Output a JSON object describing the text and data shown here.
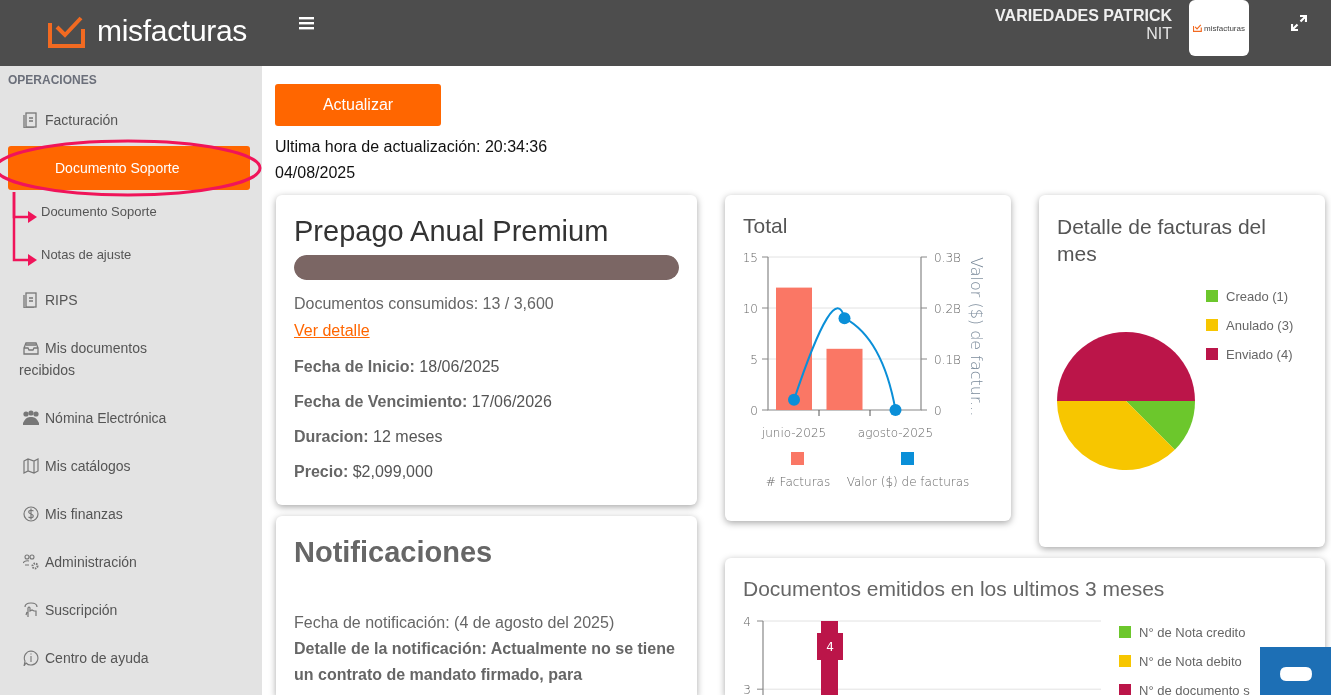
{
  "header": {
    "logo": "misfacturas",
    "company": "VARIEDADES PATRICK",
    "nit": "NIT",
    "avatar_logo": "misfacturas"
  },
  "sidebar": {
    "section": "OPERACIONES",
    "items": [
      {
        "label": "Facturación",
        "selected": false,
        "children": [
          {
            "label": "Documento Soporte",
            "selected": true,
            "children": [
              {
                "label": "Documento Soporte",
                "selected": false
              },
              {
                "label": "Notas de ajuste",
                "selected": false
              }
            ]
          }
        ]
      },
      {
        "label": "RIPS",
        "selected": false
      },
      {
        "label": "Mis documentos recibidos",
        "selected": false
      },
      {
        "label": "Nómina Electrónica",
        "selected": false
      },
      {
        "label": "Mis catálogos",
        "selected": false
      },
      {
        "label": "Mis finanzas",
        "selected": false
      },
      {
        "label": "Administración",
        "selected": false
      },
      {
        "label": "Suscripción",
        "selected": false
      },
      {
        "label": "Centro de ayuda",
        "selected": false
      }
    ]
  },
  "annotations": [
    {
      "kind": "ellipse"
    },
    {
      "kind": "arrow"
    },
    {
      "kind": "arrow"
    }
  ],
  "toolbar": {
    "button": "Actualizar",
    "last_update": "Ultima hora de actualización: 20:34:36",
    "date": "04/08/2025"
  },
  "plan": {
    "title": "Prepago Anual Premium",
    "level": 1,
    "consumed": "Documentos consumidos: 13 / 3,600",
    "link": "Ver detalle",
    "details": [
      "**Fecha de Inicio:** 18/06/2025",
      "**Fecha de Vencimiento:** 17/06/2026",
      "**Duracion:** 12 meses",
      "**Precio:** $2,099,000"
    ]
  },
  "notifications": {
    "title": "Notificaciones",
    "date": "Fecha de notificación: (4 de agosto del 2025)",
    "detail": "Detalle de la notificación: Actualmente no se tiene un contrato de mandato firmado, para"
  },
  "total": {
    "title": "Total",
    "chart_data": {
      "type": "bar",
      "categories": [
        "junio-2025",
        null,
        "agosto-2025"
      ],
      "ylim": [
        0,
        15
      ],
      "y2lim": [
        0,
        0.3
      ],
      "yticks": [
        0,
        5,
        10,
        15
      ],
      "y2label": "Valor ($) de factur...",
      "legend": "bottom",
      "y2ticks": [
        {
          "value": 0,
          "label": "0"
        },
        {
          "value": 0.1,
          "label": "0.1B"
        },
        {
          "value": 0.2,
          "label": "0.2B"
        },
        {
          "value": 0.3,
          "label": "0.3B"
        }
      ],
      "series": [
        {
          "name": "# Facturas",
          "color": "#fa7765",
          "values": [
            12,
            6,
            0
          ]
        },
        {
          "name": "Valor ($) de facturas",
          "type": "line",
          "axis": "y2",
          "marker": "o",
          "color": "#0a8fd8",
          "values": [
            0.02,
            0.18,
            0
          ]
        }
      ]
    }
  },
  "month_detail": {
    "title": "Detalle de facturas del mes",
    "chart_data": {
      "type": "pie",
      "categories": [
        "Creado (1)",
        "Anulado (3)",
        "Enviado (4)"
      ],
      "values": [
        1,
        3,
        4
      ],
      "legend": "right",
      "colors": [
        "#6cc72c",
        "#f7c600",
        "#bb1549"
      ]
    }
  },
  "documents": {
    "title": "Documentos emitidos en los ultimos 3 meses",
    "chart_data": {
      "type": "bar",
      "ylim": [
        2.9,
        4
      ],
      "yticks": [
        3,
        4
      ],
      "data_labels": true,
      "legend": "right",
      "series": [
        {
          "name": "N° de Nota credito",
          "color": "#6cc72c",
          "values": [
            null
          ]
        },
        {
          "name": "N° de Nota debito",
          "color": "#f7c600",
          "values": [
            null
          ]
        },
        {
          "name": "N° de documento s",
          "color": "#bb1549",
          "values": [
            4
          ]
        }
      ]
    }
  }
}
